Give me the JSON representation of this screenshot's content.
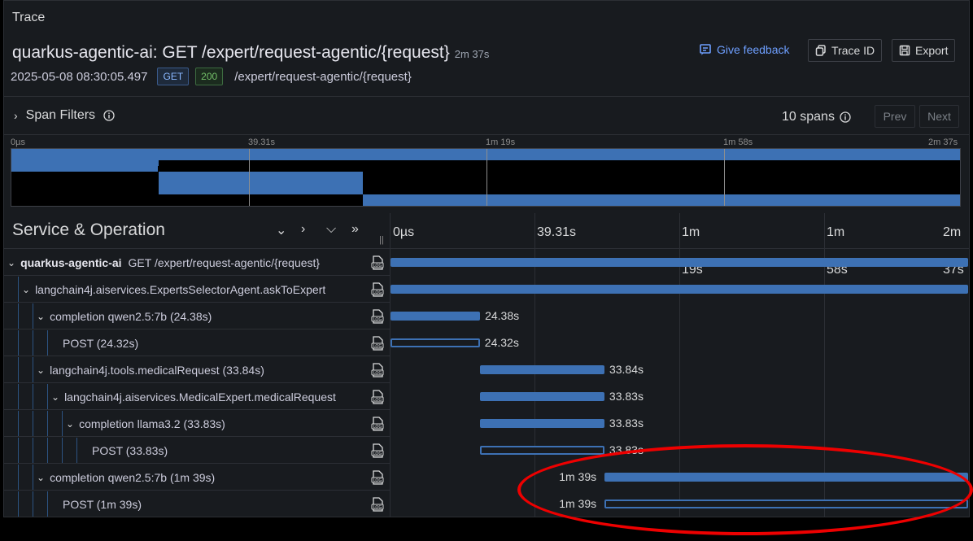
{
  "panel": {
    "title": "Trace"
  },
  "trace": {
    "service": "quarkus-agentic-ai: GET /expert/request-agentic/{request}",
    "duration": "2m 37s",
    "start_time": "2025-05-08 08:30:05.497",
    "method": "GET",
    "status": "200",
    "path": "/expert/request-agentic/{request}"
  },
  "actions": {
    "feedback": "Give feedback",
    "trace_id": "Trace ID",
    "export": "Export"
  },
  "filters": {
    "label": "Span Filters",
    "span_count": "10 spans",
    "prev": "Prev",
    "next": "Next"
  },
  "minimap": {
    "ticks": [
      "0µs",
      "39.31s",
      "1m 19s",
      "1m 58s",
      "2m 37s"
    ]
  },
  "timeline": {
    "header": "Service & Operation",
    "ticks": [
      "0µs",
      "39.31s",
      "1m",
      "1m",
      "2m"
    ],
    "tick_subs": [
      "",
      "",
      "19s",
      "58s",
      "37s"
    ],
    "total_seconds": 157.25
  },
  "spans": [
    {
      "depth": 0,
      "name": "quarkus-agentic-ai",
      "op": "GET /expert/request-agentic/{request}",
      "start": 0,
      "duration": 157.25,
      "style": "solid",
      "label": ""
    },
    {
      "depth": 1,
      "name": "",
      "op": "langchain4j.aiservices.ExpertsSelectorAgent.askToExpert",
      "start": 0,
      "duration": 157.25,
      "style": "solid",
      "label": ""
    },
    {
      "depth": 2,
      "name": "",
      "op": "completion qwen2.5:7b (24.38s)",
      "start": 0,
      "duration": 24.38,
      "style": "solid",
      "label": "24.38s"
    },
    {
      "depth": 3,
      "name": "",
      "op": "POST (24.32s)",
      "start": 0,
      "duration": 24.32,
      "style": "outline",
      "label": "24.32s"
    },
    {
      "depth": 2,
      "name": "",
      "op": "langchain4j.tools.medicalRequest (33.84s)",
      "start": 24.4,
      "duration": 33.84,
      "style": "solid",
      "label": "33.84s"
    },
    {
      "depth": 3,
      "name": "",
      "op": "langchain4j.aiservices.MedicalExpert.medicalRequest",
      "start": 24.4,
      "duration": 33.83,
      "style": "solid",
      "label": "33.83s"
    },
    {
      "depth": 4,
      "name": "",
      "op": "completion llama3.2 (33.83s)",
      "start": 24.4,
      "duration": 33.83,
      "style": "solid",
      "label": "33.83s"
    },
    {
      "depth": 5,
      "name": "",
      "op": "POST (33.83s)",
      "start": 24.4,
      "duration": 33.83,
      "style": "outline",
      "label": "33.83s"
    },
    {
      "depth": 2,
      "name": "",
      "op": "completion qwen2.5:7b (1m 39s)",
      "start": 58.3,
      "duration": 99,
      "style": "solid",
      "label": "1m 39s"
    },
    {
      "depth": 3,
      "name": "",
      "op": "POST (1m 39s)",
      "start": 58.3,
      "duration": 99,
      "style": "outline",
      "label": "1m 39s"
    }
  ]
}
